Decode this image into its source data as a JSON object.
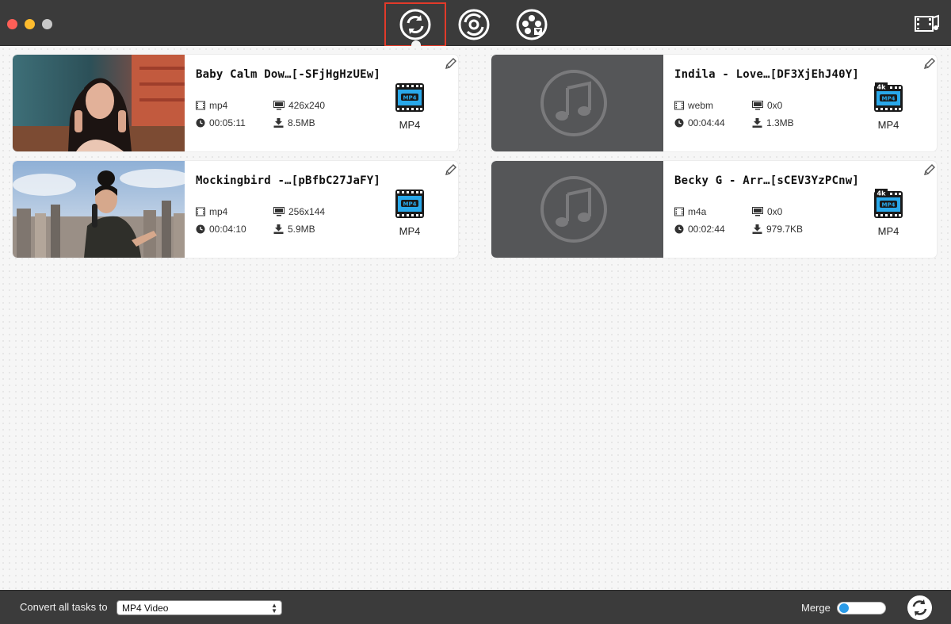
{
  "window": {
    "title_bar_buttons": [
      "close",
      "minimize",
      "maximize"
    ]
  },
  "toolbar": {
    "tabs": [
      {
        "icon": "convert-icon",
        "active": true
      },
      {
        "icon": "burn-dvd-icon",
        "active": false
      },
      {
        "icon": "film-download-icon",
        "active": false
      }
    ],
    "right_icon": "media-browser-icon"
  },
  "tasks": [
    {
      "title": "Baby Calm Dow…[-SFjHgHzUEw]",
      "format": "mp4",
      "resolution": "426x240",
      "duration": "00:05:11",
      "size": "8.5MB",
      "target_format": "MP4",
      "target_badge": "MP4",
      "thumbnail": "video"
    },
    {
      "title": "Indila - Love…[DF3XjEhJ40Y]",
      "format": "webm",
      "resolution": "0x0",
      "duration": "00:04:44",
      "size": "1.3MB",
      "target_format": "MP4",
      "target_badge": "4K",
      "thumbnail": "audio"
    },
    {
      "title": "Mockingbird -…[pBfbC27JaFY]",
      "format": "mp4",
      "resolution": "256x144",
      "duration": "00:04:10",
      "size": "5.9MB",
      "target_format": "MP4",
      "target_badge": "MP4",
      "thumbnail": "video"
    },
    {
      "title": "Becky G - Arr…[sCEV3YzPCnw]",
      "format": "m4a",
      "resolution": "0x0",
      "duration": "00:02:44",
      "size": "979.7KB",
      "target_format": "MP4",
      "target_badge": "4K",
      "thumbnail": "audio"
    }
  ],
  "footer": {
    "convert_all_label": "Convert all tasks to",
    "convert_all_value": "MP4 Video",
    "merge_label": "Merge",
    "merge_enabled": false
  },
  "colors": {
    "accent": "#2a9be8",
    "active_tab_outline": "#e23a2a",
    "titlebar": "#3b3b3b"
  }
}
